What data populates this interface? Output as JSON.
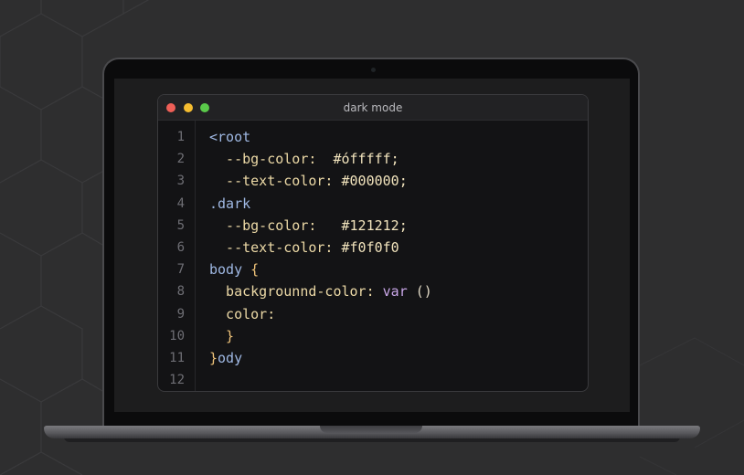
{
  "window": {
    "title": "dark mode"
  },
  "editor": {
    "line_numbers": [
      "1",
      "2",
      "3",
      "4",
      "5",
      "6",
      "7",
      "8",
      "9",
      "10",
      "11",
      "12"
    ],
    "lines": [
      {
        "tokens": [
          {
            "text": "<root",
            "role": "selector"
          }
        ]
      },
      {
        "tokens": [
          {
            "text": "  --bg-color:",
            "role": "property"
          },
          {
            "text": "  #",
            "role": "value"
          },
          {
            "text": "ó",
            "role": "value"
          },
          {
            "text": "fffff;",
            "role": "value"
          }
        ]
      },
      {
        "tokens": [
          {
            "text": "  --text-color:",
            "role": "property"
          },
          {
            "text": " #000000;",
            "role": "value"
          }
        ]
      },
      {
        "tokens": [
          {
            "text": ".dark",
            "role": "selector"
          }
        ]
      },
      {
        "tokens": [
          {
            "text": "  --bg-color:",
            "role": "property"
          },
          {
            "text": "   #121212;",
            "role": "value"
          }
        ]
      },
      {
        "tokens": [
          {
            "text": "  --text-color:",
            "role": "property"
          },
          {
            "text": " #f0f0f0",
            "role": "value"
          }
        ]
      },
      {
        "tokens": [
          {
            "text": "body",
            "role": "selector"
          },
          {
            "text": " {",
            "role": "brace"
          }
        ]
      },
      {
        "tokens": [
          {
            "text": "  backgrounnd-color:",
            "role": "property"
          },
          {
            "text": " var",
            "role": "function"
          },
          {
            "text": " ()",
            "role": "punctuation"
          }
        ]
      },
      {
        "tokens": [
          {
            "text": "  color:",
            "role": "property"
          }
        ]
      },
      {
        "tokens": [
          {
            "text": "  }",
            "role": "brace"
          }
        ]
      },
      {
        "tokens": [
          {
            "text": "}",
            "role": "brace"
          },
          {
            "text": "ody",
            "role": "selector"
          }
        ]
      },
      {
        "tokens": []
      }
    ]
  },
  "colors": {
    "background": "#2e2e2f",
    "editor_bg": "#131315",
    "titlebar_bg": "#222224",
    "close_dot": "#ee5f57",
    "minimize_dot": "#f5bd30",
    "zoom_dot": "#5ac94a",
    "selector": "#9fb8e3",
    "property": "#ecd9a6",
    "value": "#f2e4bd",
    "function": "#c9a7e8",
    "brace": "#f0c47a"
  }
}
